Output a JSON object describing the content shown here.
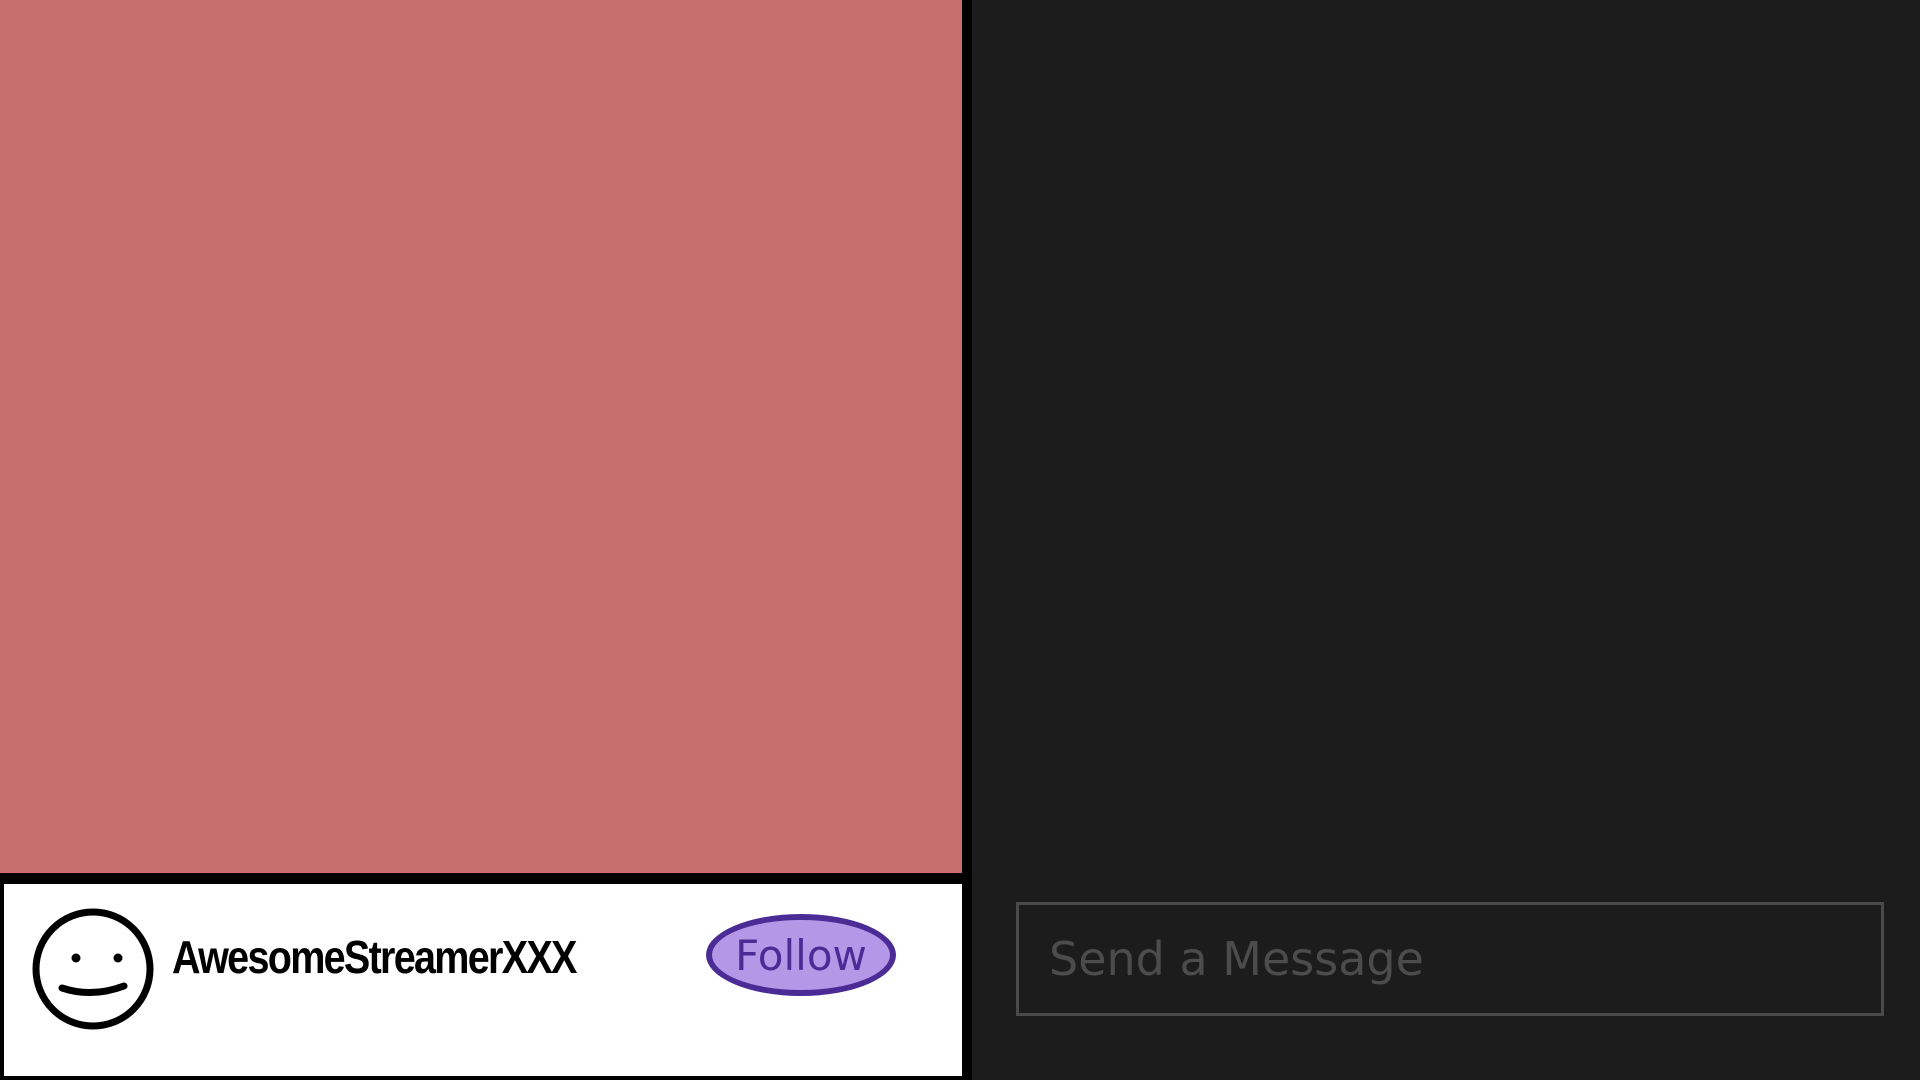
{
  "stream": {
    "video_color": "#c76f6e"
  },
  "streamer": {
    "name": "AwesomeStreamerXXX",
    "avatar_icon": "smiley-face-icon",
    "follow_label": "Follow"
  },
  "chat": {
    "input_value": "",
    "input_placeholder": "Send a Message"
  },
  "colors": {
    "chat_background": "#1c1c1c",
    "follow_fill": "#b497e6",
    "follow_border": "#4b2b96",
    "frame": "#000000"
  }
}
